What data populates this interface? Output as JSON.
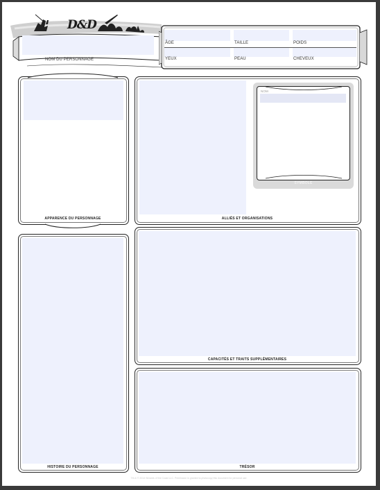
{
  "header": {
    "logo_text": "D&D",
    "name_label": "NOM DU PERSONNAGE"
  },
  "details": {
    "age_label": "ÂGE",
    "height_label": "TAILLE",
    "weight_label": "POIDS",
    "eyes_label": "YEUX",
    "skin_label": "PEAU",
    "hair_label": "CHEVEUX"
  },
  "sections": {
    "appearance": "APPARENCE DU PERSONNAGE",
    "allies": "ALLIÉS ET ORGANISATIONS",
    "symbol_name_label": "NOM",
    "symbol_caption": "SYMBOLE",
    "backstory": "HISTOIRE DU PERSONNAGE",
    "features": "CAPACITÉS ET TRAITS SUPPLÉMENTAIRES",
    "treasure": "TRÉSOR"
  },
  "footer": {
    "legal": "TM & © 2014 Wizards of the Coast LLC. Permission is granted to photocopy this document for personal use."
  },
  "colors": {
    "field_fill": "#eef1fd",
    "border": "#222222",
    "page_bg": "#3a3a3a"
  }
}
